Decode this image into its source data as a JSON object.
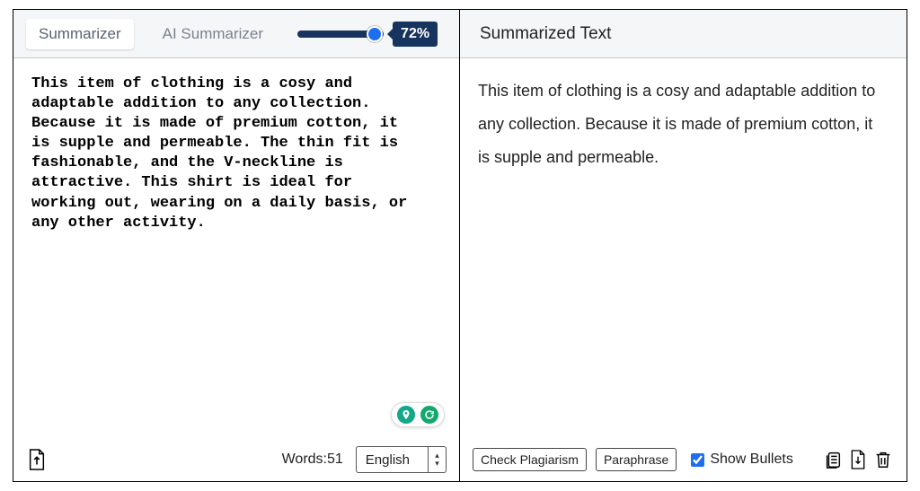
{
  "left": {
    "tabs": [
      {
        "label": "Summarizer",
        "active": true
      },
      {
        "label": "AI Summarizer",
        "active": false
      }
    ],
    "slider_percent": "72%",
    "source_text": "This item of clothing is a cosy and\nadaptable addition to any collection.\nBecause it is made of premium cotton, it\nis supple and permeable. The thin fit is\nfashionable, and the V-neckline is\nattractive. This shirt is ideal for\nworking out, wearing on a daily basis, or\nany other activity.",
    "word_label": "Words:",
    "word_count": "51",
    "language": "English"
  },
  "right": {
    "title": "Summarized Text",
    "output_text": "This item of clothing is a cosy and adaptable addition to any collection. Because it is made of premium cotton, it is supple and permeable.",
    "check_plagiarism": "Check Plagiarism",
    "paraphrase": "Paraphrase",
    "show_bullets": "Show Bullets",
    "show_bullets_checked": true
  },
  "icons": {
    "upload": "upload-icon",
    "pin": "pin-icon",
    "refresh": "refresh-icon",
    "copy": "copy-icon",
    "download": "download-icon",
    "trash": "trash-icon",
    "stepper": "stepper-icon"
  },
  "colors": {
    "navy": "#17345e",
    "blue": "#1e6ff0",
    "teal": "#14a889"
  }
}
